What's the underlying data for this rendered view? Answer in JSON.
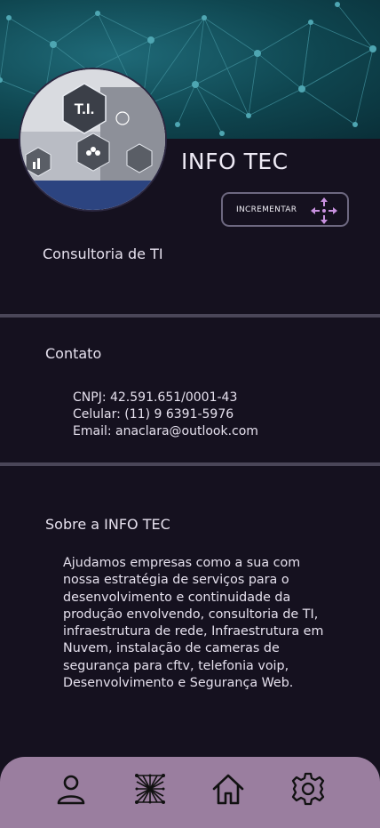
{
  "header": {
    "brand_name": "INFO TEC",
    "avatar_text": "T.I.",
    "increment_label": "INCREMENTAR"
  },
  "company": {
    "tagline": "Consultoria de TI"
  },
  "contact": {
    "title": "Contato",
    "cnpj": "CNPJ: 42.591.651/0001-43",
    "phone": "Celular: (11) 9 6391-5976",
    "email": "Email: anaclara@outlook.com"
  },
  "about": {
    "title": "Sobre a INFO TEC",
    "text": "Ajudamos empresas como a sua com nossa estratégia de serviços para o desenvolvimento e continuidade da produção  envolvendo, consultoria de TI, infraestrutura de rede, Infraestrutura em Nuvem, instalação de cameras de segurança para cftv, telefonia voip, Desenvolvimento e Segurança Web."
  },
  "bottom_nav": {
    "items": [
      {
        "name": "profile",
        "icon": "user-icon"
      },
      {
        "name": "network",
        "icon": "network-icon"
      },
      {
        "name": "home",
        "icon": "home-icon"
      },
      {
        "name": "settings",
        "icon": "gear-icon"
      }
    ]
  },
  "colors": {
    "background": "#15111f",
    "banner": "#0f4650",
    "divider": "#4a4658",
    "nav_bar": "#9a7e9f",
    "accent_icon": "#c992e0"
  }
}
